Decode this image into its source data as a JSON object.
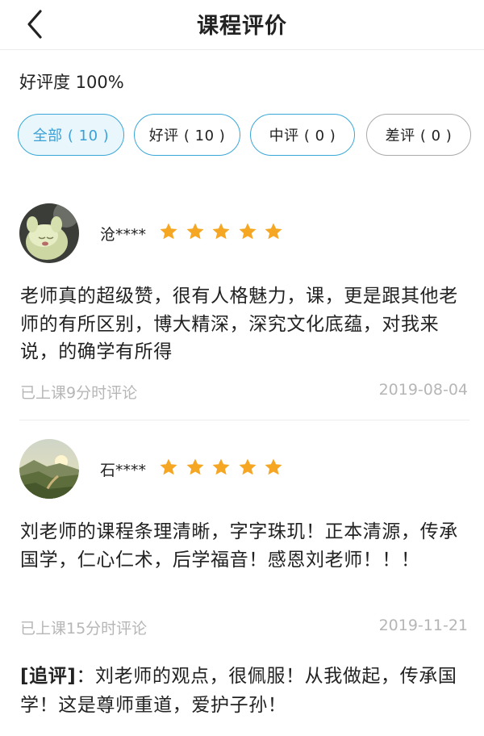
{
  "header": {
    "title": "课程评价",
    "back_icon": "chevron-left-icon"
  },
  "rating": {
    "text": "好评度 100%"
  },
  "filters": [
    {
      "label": "全部 ( 10 )",
      "active": true
    },
    {
      "label": "好评 ( 10 )",
      "active": false
    },
    {
      "label": "中评 ( 0 )",
      "active": false
    },
    {
      "label": "差评 ( 0 )",
      "active": false
    }
  ],
  "reviews": [
    {
      "user": "沧****",
      "stars": 5,
      "content": "老师真的超级赞，很有人格魅力，课，更是跟其他老师的有所区别，博大精深，深究文化底蕴，对我来说，的确学有所得",
      "meta": "已上课9分时评论",
      "date": "2019-08-04"
    },
    {
      "user": "石****",
      "stars": 5,
      "content": "刘老师的课程条理清晰，字字珠玑！正本清源，传承国学，仁心仁术，后学福音！感恩刘老师！！！",
      "meta": "已上课15分时评论",
      "date": "2019-11-21",
      "follow_label": "[追评]",
      "follow_text": "：刘老师的观点，很佩服！从我做起，传承国学！这是尊师重道，爱护子孙！"
    }
  ],
  "colors": {
    "accent": "#3aa7d8",
    "star": "#f5a623",
    "muted": "#b6b6b6"
  }
}
